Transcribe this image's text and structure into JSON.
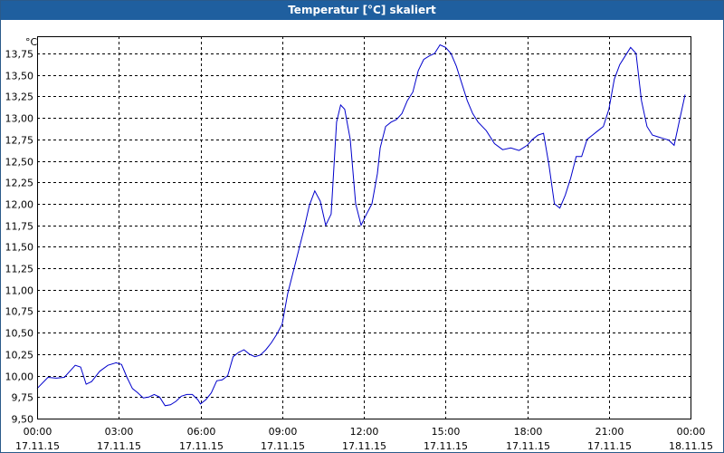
{
  "window": {
    "title": "Temperatur [°C] skaliert"
  },
  "colors": {
    "line": "#0000cc",
    "grid": "#000000",
    "titlebar": "#1f5f9f"
  },
  "chart_data": {
    "type": "line",
    "title": "Temperatur [°C] skaliert",
    "ylabel": "°C",
    "ylim": [
      9.5,
      13.95
    ],
    "xlim_hours": [
      0,
      24
    ],
    "grid": true,
    "yticks": [
      9.5,
      9.75,
      10.0,
      10.25,
      10.5,
      10.75,
      11.0,
      11.25,
      11.5,
      11.75,
      12.0,
      12.25,
      12.5,
      12.75,
      13.0,
      13.25,
      13.5,
      13.75
    ],
    "ytick_labels": [
      "9,50",
      "9,75",
      "10,00",
      "10,25",
      "10,50",
      "10,75",
      "11,00",
      "11,25",
      "11,50",
      "11,75",
      "12,00",
      "12,25",
      "12,50",
      "12,75",
      "13,00",
      "13,25",
      "13,50",
      "13,75"
    ],
    "xticks": [
      {
        "time": "00:00",
        "date": "17.11.15"
      },
      {
        "time": "03:00",
        "date": "17.11.15"
      },
      {
        "time": "06:00",
        "date": "17.11.15"
      },
      {
        "time": "09:00",
        "date": "17.11.15"
      },
      {
        "time": "12:00",
        "date": "17.11.15"
      },
      {
        "time": "15:00",
        "date": "17.11.15"
      },
      {
        "time": "18:00",
        "date": "17.11.15"
      },
      {
        "time": "21:00",
        "date": "17.11.15"
      },
      {
        "time": "00:00",
        "date": "18.11.15"
      }
    ],
    "series": [
      {
        "x": [
          0.0,
          0.4,
          0.7,
          1.0,
          1.2,
          1.4,
          1.6,
          1.8,
          2.0,
          2.3,
          2.6,
          2.9,
          3.1,
          3.3,
          3.5,
          3.7,
          3.9,
          4.1,
          4.3,
          4.5,
          4.7,
          4.9,
          5.1,
          5.3,
          5.5,
          5.7,
          5.9,
          6.0,
          6.2,
          6.4,
          6.6,
          6.8,
          7.0,
          7.2,
          7.4,
          7.6,
          7.8,
          8.0,
          8.2,
          8.4,
          8.6,
          8.8,
          9.0,
          9.2,
          9.4,
          9.6,
          9.8,
          10.0,
          10.2,
          10.4,
          10.6,
          10.8,
          11.0,
          11.15,
          11.3,
          11.5,
          11.7,
          11.9,
          12.1,
          12.3,
          12.5,
          12.6,
          12.8,
          13.0,
          13.2,
          13.4,
          13.6,
          13.8,
          14.0,
          14.2,
          14.4,
          14.6,
          14.8,
          15.0,
          15.2,
          15.4,
          15.6,
          15.8,
          16.0,
          16.2,
          16.5,
          16.8,
          17.1,
          17.4,
          17.7,
          18.0,
          18.2,
          18.4,
          18.6,
          18.8,
          19.0,
          19.2,
          19.4,
          19.6,
          19.8,
          20.0,
          20.2,
          20.4,
          20.6,
          20.8,
          21.0,
          21.2,
          21.4,
          21.6,
          21.8,
          22.0,
          22.2,
          22.4,
          22.6,
          22.8,
          23.0,
          23.2,
          23.4,
          23.6,
          23.8
        ],
        "y": [
          9.85,
          9.98,
          9.97,
          9.98,
          10.05,
          10.12,
          10.1,
          9.9,
          9.93,
          10.05,
          10.12,
          10.15,
          10.13,
          9.98,
          9.85,
          9.8,
          9.74,
          9.75,
          9.78,
          9.75,
          9.65,
          9.66,
          9.7,
          9.76,
          9.78,
          9.78,
          9.72,
          9.67,
          9.72,
          9.8,
          9.94,
          9.95,
          10.0,
          10.22,
          10.27,
          10.3,
          10.25,
          10.22,
          10.24,
          10.3,
          10.38,
          10.48,
          10.6,
          10.95,
          11.2,
          11.45,
          11.7,
          11.98,
          12.15,
          12.03,
          11.75,
          11.88,
          12.95,
          13.15,
          13.1,
          12.75,
          12.0,
          11.75,
          11.88,
          12.0,
          12.35,
          12.65,
          12.9,
          12.95,
          12.98,
          13.05,
          13.2,
          13.3,
          13.55,
          13.68,
          13.72,
          13.75,
          13.85,
          13.82,
          13.75,
          13.6,
          13.4,
          13.2,
          13.05,
          12.95,
          12.85,
          12.7,
          12.63,
          12.65,
          12.62,
          12.68,
          12.75,
          12.8,
          12.82,
          12.45,
          12.0,
          11.95,
          12.1,
          12.3,
          12.55,
          12.55,
          12.75,
          12.8,
          12.85,
          12.9,
          13.1,
          13.45,
          13.62,
          13.72,
          13.82,
          13.75,
          13.2,
          12.9,
          12.8,
          12.78,
          12.76,
          12.74,
          12.68,
          12.98,
          13.27
        ]
      }
    ]
  }
}
